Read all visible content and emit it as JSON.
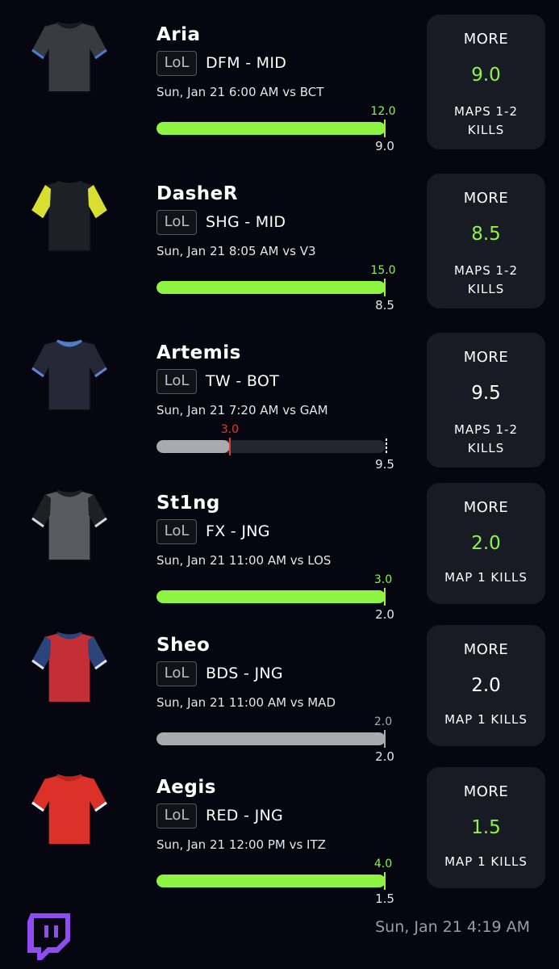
{
  "game_label": "LoL",
  "more_label": "MORE",
  "colors": {
    "green": "#8df542",
    "gray": "#a9aaae",
    "red": "#e53b2f",
    "card": "#191b24",
    "background": "#05060f"
  },
  "players": [
    {
      "name": "Aria",
      "team": "DFM - MID",
      "match": "Sun, Jan 21 6:00 AM  vs BCT",
      "actual": "12.0",
      "line": "9.0",
      "result": "over",
      "progress": 1.0,
      "stat_lines": [
        "MAPS 1-2",
        "KILLS"
      ],
      "jersey": {
        "body": "#3a3b40",
        "sleeve": "#3a3b40",
        "trim": "#4c7bd8",
        "collar": "#1a1b20"
      }
    },
    {
      "name": "DasheR",
      "team": "SHG - MID",
      "match": "Sun, Jan 21 8:05 AM  vs V3",
      "actual": "15.0",
      "line": "8.5",
      "result": "over",
      "progress": 1.0,
      "stat_lines": [
        "MAPS 1-2",
        "KILLS"
      ],
      "jersey": {
        "body": "#1d2127",
        "sleeve": "#d9df30",
        "trim": "#d9df30",
        "collar": "#1d2127"
      }
    },
    {
      "name": "Artemis",
      "team": "TW - BOT",
      "match": "Sun, Jan 21 7:20 AM  vs GAM",
      "actual": "3.0",
      "line": "9.5",
      "result": "under",
      "progress": 0.32,
      "stat_lines": [
        "MAPS 1-2",
        "KILLS"
      ],
      "jersey": {
        "body": "#262837",
        "sleeve": "#262837",
        "trim": "#5d8ad6",
        "collar": "#4f7fcc"
      }
    },
    {
      "name": "St1ng",
      "team": "FX - JNG",
      "match": "Sun, Jan 21 11:00 AM  vs LOS",
      "actual": "3.0",
      "line": "2.0",
      "result": "over",
      "progress": 1.0,
      "stat_lines": [
        "MAP 1 KILLS"
      ],
      "jersey": {
        "body": "#5a5b60",
        "sleeve": "#1f2024",
        "trim": "#d8d8dc",
        "collar": "#1f2024"
      }
    },
    {
      "name": "Sheo",
      "team": "BDS - JNG",
      "match": "Sun, Jan 21 11:00 AM  vs MAD",
      "actual": "2.0",
      "line": "2.0",
      "result": "push",
      "progress": 1.0,
      "stat_lines": [
        "MAP 1 KILLS"
      ],
      "jersey": {
        "body": "#c42e36",
        "sleeve": "#2b4479",
        "trim": "#dfe2ea",
        "collar": "#2b4479"
      }
    },
    {
      "name": "Aegis",
      "team": "RED - JNG",
      "match": "Sun, Jan 21 12:00 PM  vs ITZ",
      "actual": "4.0",
      "line": "1.5",
      "result": "over",
      "progress": 1.0,
      "stat_lines": [
        "MAP 1 KILLS"
      ],
      "jersey": {
        "body": "#dc3128",
        "sleeve": "#dc3128",
        "trim": "#ffffff",
        "collar": "#b8231c"
      }
    }
  ],
  "footer": {
    "timestamp": "Sun, Jan 21 4:19 AM",
    "logo_icon": "twitch-icon"
  }
}
